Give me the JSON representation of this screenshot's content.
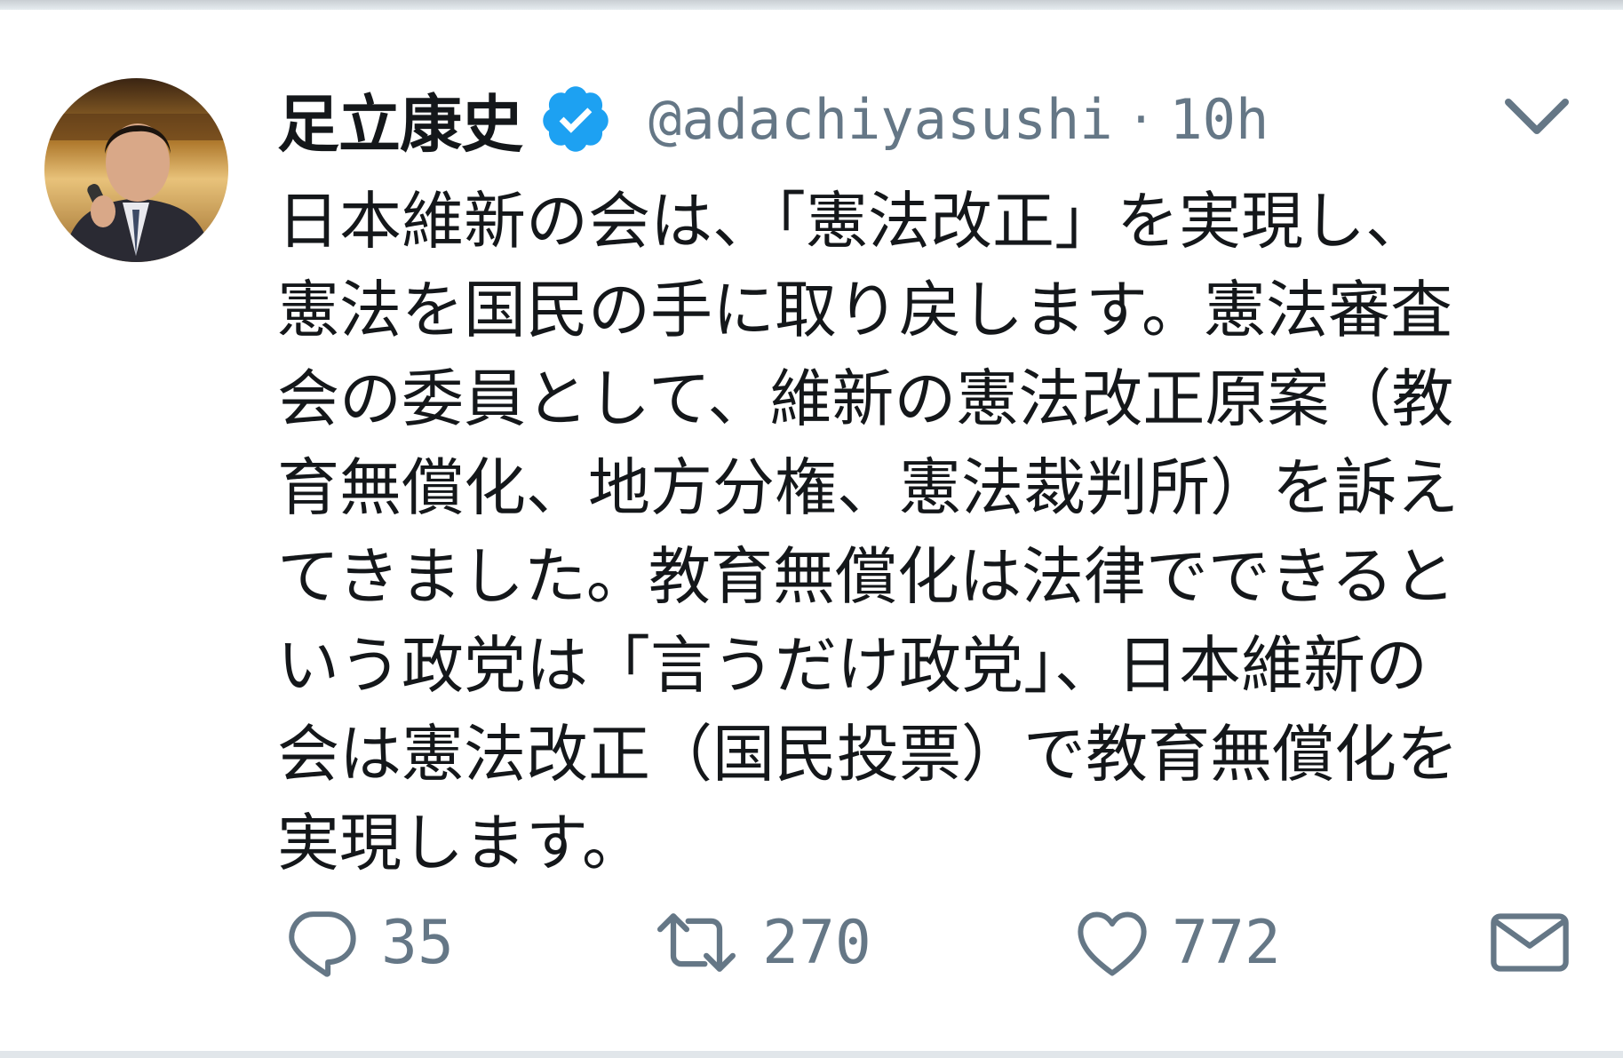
{
  "tweet": {
    "display_name": "足立康史",
    "handle": "@adachiyasushi",
    "separator": "·",
    "time": "10h",
    "verified": true,
    "text_lines": [
      "日本維新の会は、「憲法改正」を実現し、",
      "憲法を国民の手に取り戻します。憲法審査",
      "会の委員として、維新の憲法改正原案（教",
      "育無償化、地方分権、憲法裁判所）を訴え",
      "てきました。教育無償化は法律でできると",
      "いう政党は「言うだけ政党」、日本維新の",
      "会は憲法改正（国民投票）で教育無償化を",
      "実現します。"
    ],
    "actions": {
      "reply_count": "35",
      "retweet_count": "270",
      "like_count": "772"
    }
  },
  "icons": {
    "verified": "verified-badge-icon",
    "caret": "chevron-down-icon",
    "reply": "reply-icon",
    "retweet": "retweet-icon",
    "like": "heart-icon",
    "dm": "envelope-icon"
  },
  "colors": {
    "text": "#14171a",
    "secondary": "#657786",
    "verified_blue": "#1da1f2",
    "divider": "#e1e6ea"
  }
}
